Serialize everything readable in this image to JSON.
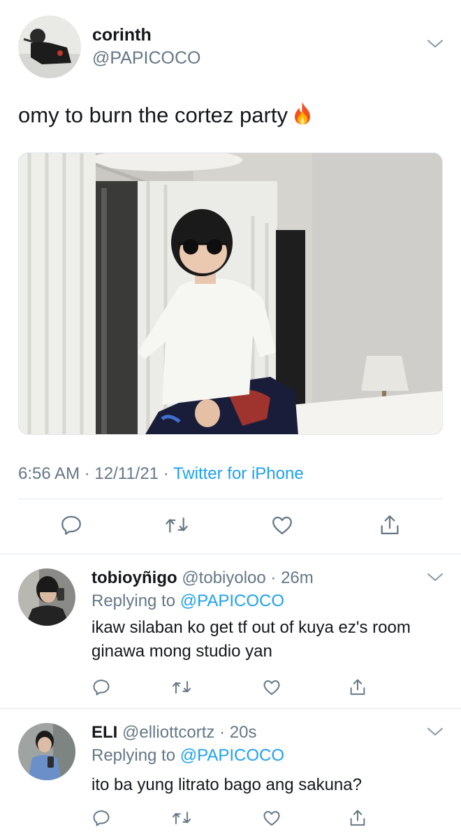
{
  "main_tweet": {
    "name": "corinth",
    "handle": "@PAPICOCO",
    "text": "omy to burn the cortez party",
    "emoji_icon": "fire-icon",
    "time": "6:56 AM",
    "date": "12/11/21",
    "source": "Twitter for iPhone",
    "separator": " · ",
    "actions": [
      "reply-icon",
      "retweet-icon",
      "like-icon",
      "share-icon"
    ]
  },
  "replies": [
    {
      "name": "tobioyñigo",
      "handle": "@tobiyoloo",
      "time": "26m",
      "replying_label": "Replying to",
      "replying_to": "@PAPICOCO",
      "text": "ikaw silaban ko get tf out of kuya ez's room ginawa mong studio yan"
    },
    {
      "name": "ELI",
      "handle": "@elliottcortz",
      "time": "20s",
      "replying_label": "Replying to",
      "replying_to": "@PAPICOCO",
      "text": "ito ba yung litrato bago ang sakuna?"
    }
  ],
  "colors": {
    "text": "#14171a",
    "secondary": "#657786",
    "accent": "#1da1f2",
    "divider": "#e1e8ed"
  }
}
